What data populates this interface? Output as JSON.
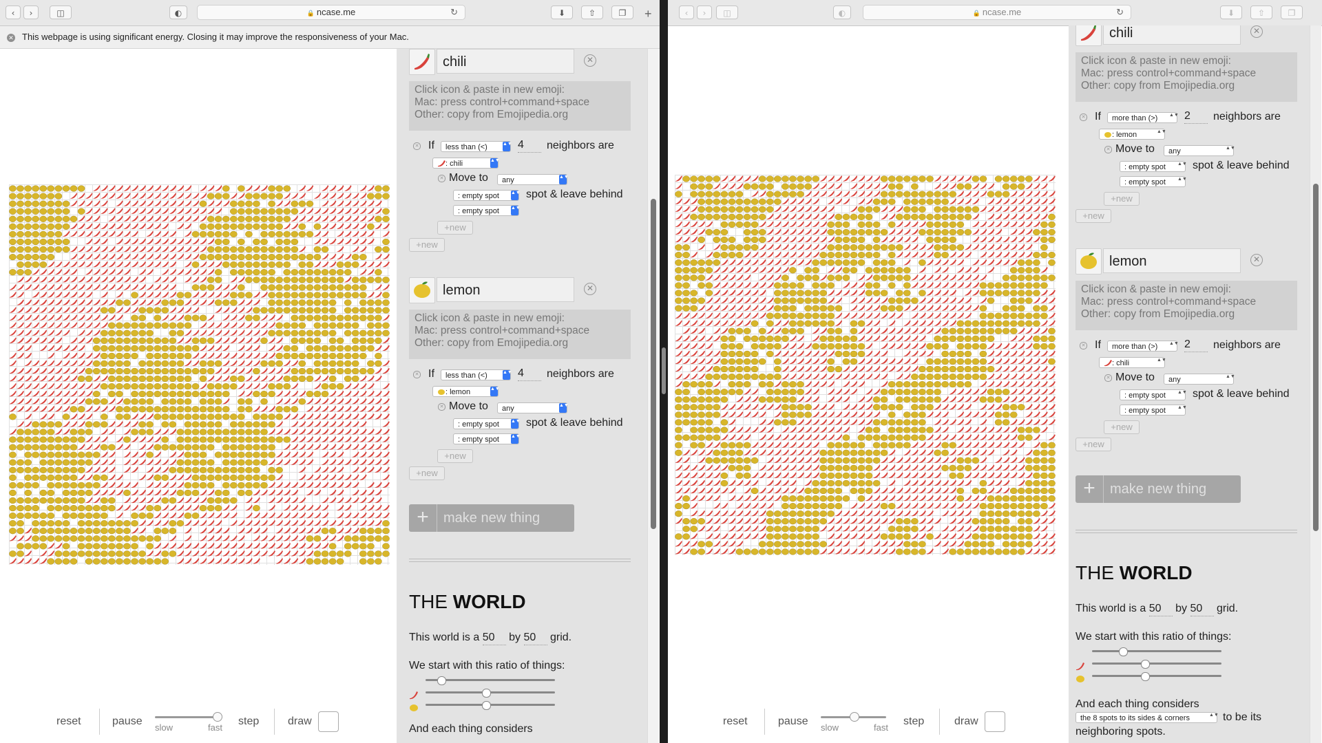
{
  "browser": {
    "url": "ncase.me",
    "lock_icon": "lock-icon",
    "energy_banner": "This webpage is using significant energy. Closing it may improve the responsiveness of your Mac."
  },
  "colors": {
    "chili": "#d9433c",
    "lemon": "#d8b62a",
    "accent": "#3478f6",
    "panel": "#e3e3e3"
  },
  "controls": {
    "reset": "reset",
    "pause": "pause",
    "slow": "slow",
    "fast": "fast",
    "step": "step",
    "draw": "draw",
    "left_speed": 0.95,
    "right_speed": 0.5
  },
  "things": [
    {
      "emoji_icon": "chili-pepper-icon",
      "name": "chili",
      "hint": [
        "Click icon & paste in new emoji:",
        "Mac: press control+command+space",
        "Other: copy from Emojipedia.org"
      ],
      "rule_left": {
        "if": "If",
        "comparison": "less than (<)",
        "number": "4",
        "neighbors_are": "neighbors are",
        "neighbor": ": chili",
        "move_to": "Move to",
        "move_target": "any",
        "spot1": ": empty spot",
        "spot_leave": "spot & leave behind",
        "spot2": ": empty spot"
      },
      "rule_right": {
        "if": "If",
        "comparison": "more than (>)",
        "number": "2",
        "neighbors_are": "neighbors are",
        "neighbor": ": lemon",
        "move_to": "Move to",
        "move_target": "any",
        "spot1": ": empty spot",
        "spot_leave": "spot & leave behind",
        "spot2": ": empty spot"
      },
      "new_label": "+new"
    },
    {
      "emoji_icon": "lemon-icon",
      "name": "lemon",
      "hint": [
        "Click icon & paste in new emoji:",
        "Mac: press control+command+space",
        "Other: copy from Emojipedia.org"
      ],
      "rule_left": {
        "if": "If",
        "comparison": "less than (<)",
        "number": "4",
        "neighbors_are": "neighbors are",
        "neighbor": ": lemon",
        "move_to": "Move to",
        "move_target": "any",
        "spot1": ": empty spot",
        "spot_leave": "spot & leave behind",
        "spot2": ": empty spot"
      },
      "rule_right": {
        "if": "If",
        "comparison": "more than (>)",
        "number": "2",
        "neighbors_are": "neighbors are",
        "neighbor": ": chili",
        "move_to": "Move to",
        "move_target": "any",
        "spot1": ": empty spot",
        "spot_leave": "spot & leave behind",
        "spot2": ": empty spot"
      },
      "new_label": "+new"
    }
  ],
  "make_new_thing": "make new thing",
  "world": {
    "title_prefix": "THE ",
    "title_bold": "WORLD",
    "size_text_a": "This world is a",
    "width": "50",
    "size_text_b": "by",
    "height": "50",
    "size_text_c": "grid.",
    "ratio_text": "We start with this ratio of things:",
    "ratio_left": [
      0.12,
      0.47,
      0.47
    ],
    "ratio_right": [
      0.24,
      0.41,
      0.41
    ],
    "considers_text": "And each thing considers",
    "neighborhood": "the 8 spots to its sides & corners",
    "neighbors_suffix_a": "to be its",
    "neighbors_suffix_b": "neighboring spots."
  }
}
